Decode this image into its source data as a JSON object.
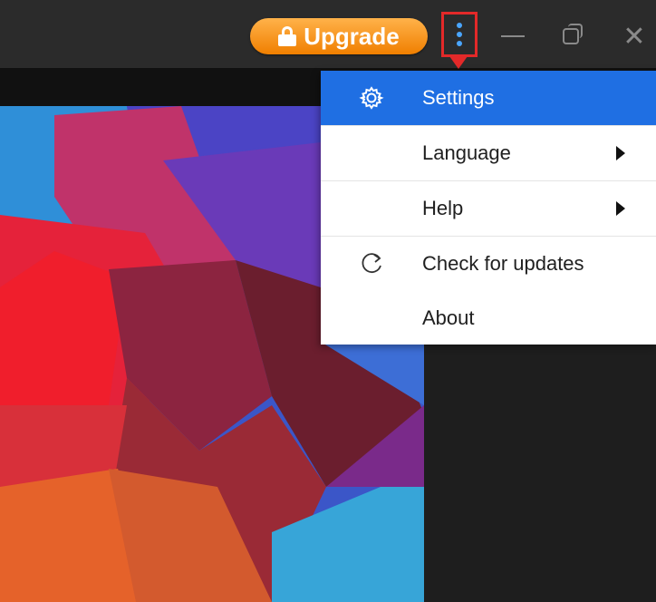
{
  "titlebar": {
    "upgrade_label": "Upgrade",
    "close_glyph": "✕"
  },
  "menu": {
    "items": [
      {
        "label": "Settings",
        "icon": "gear-icon",
        "submenu": false,
        "selected": true
      },
      {
        "label": "Language",
        "icon": "",
        "submenu": true,
        "selected": false
      },
      {
        "label": "Help",
        "icon": "",
        "submenu": true,
        "selected": false
      },
      {
        "label": "Check for updates",
        "icon": "refresh-icon",
        "submenu": false,
        "selected": false
      },
      {
        "label": "About",
        "icon": "",
        "submenu": false,
        "selected": false
      }
    ]
  },
  "colors": {
    "accent": "#1f6fe3",
    "upgrade_orange": "#f59a1b",
    "highlight_red": "#e32929",
    "titlebar_bg": "#2b2b2b"
  }
}
